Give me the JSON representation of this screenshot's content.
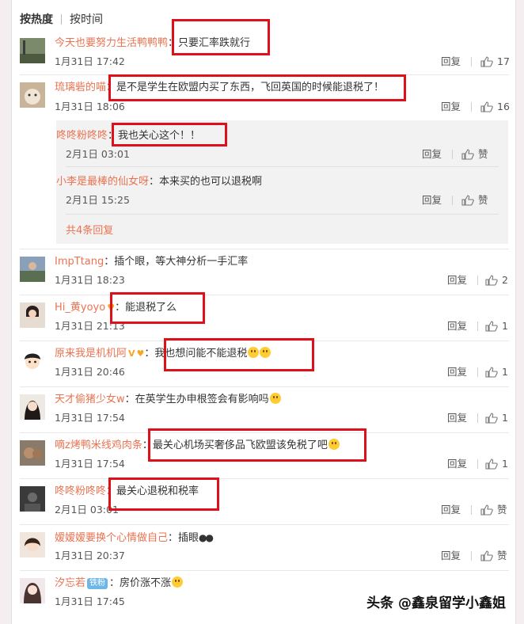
{
  "tabs": {
    "hot": "按热度",
    "time": "按时间"
  },
  "reply_label": "回复",
  "like_label": "赞",
  "comments": [
    {
      "user": "今天也要努力生活鸭鸭鸭",
      "text": "只要汇率跌就行",
      "time": "1月31日 17:42",
      "likes": "17"
    },
    {
      "user": "琉璃砦的喵",
      "text": "是不是学生在欧盟内买了东西，飞回英国的时候能退税了！",
      "time": "1月31日 18:06",
      "likes": "16"
    },
    {
      "user": "ImpTtang",
      "text": "插个眼，等大神分析一手汇率",
      "time": "1月31日 18:23",
      "likes": "2"
    },
    {
      "user": "Hi_黄yoyo",
      "text": "能退税了么",
      "time": "1月31日 21:13",
      "likes": "1"
    },
    {
      "user": "原来我是机机阿",
      "text": "我也想问能不能退税",
      "time": "1月31日 20:46",
      "likes": "1"
    },
    {
      "user": "天才偷猪少女w",
      "text": "在英学生办申根签会有影响吗",
      "time": "1月31日 17:54",
      "likes": "1"
    },
    {
      "user": "嘀z烤鸭米线鸡肉条",
      "text": "最关心机场买奢侈品飞欧盟该免税了吧",
      "time": "1月31日 17:54",
      "likes": "1"
    },
    {
      "user": "咚咚粉咚咚",
      "text": "最关心退税和税率",
      "time": "2月1日 03:01",
      "likes": "赞"
    },
    {
      "user": "嫒嫒嫒要换个心情做自己",
      "text": "插眼",
      "time": "1月31日 20:37",
      "likes": "赞"
    },
    {
      "user": "汐忘若",
      "badge": "铁粉",
      "text": "房价涨不涨",
      "time": "1月31日 17:45",
      "likes": ""
    }
  ],
  "sub_replies": [
    {
      "user": "咚咚粉咚咚",
      "text": "我也关心这个！！",
      "time": "2月1日 03:01"
    },
    {
      "user": "小李是最棒的仙女呀",
      "text": "本来买的也可以退税啊",
      "time": "2月1日 15:25"
    }
  ],
  "more_replies": "共4条回复",
  "watermark": "头条 @鑫泉留学小鑫姐",
  "colors": {
    "username": "#eb7350",
    "highlight_box": "#e0101a",
    "badge": "#6fb6e8"
  }
}
